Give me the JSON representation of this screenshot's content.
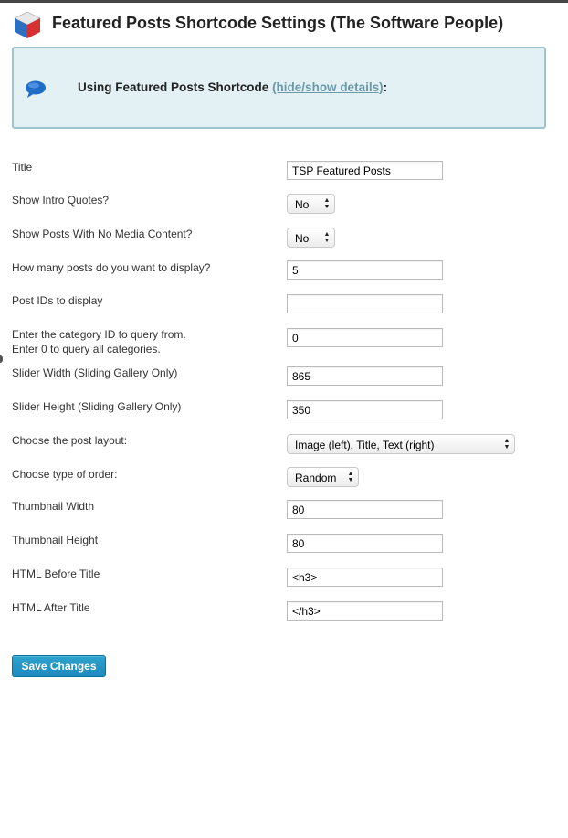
{
  "page": {
    "title": "Featured Posts Shortcode Settings (The Software People)"
  },
  "info_box": {
    "text": "Using Featured Posts Shortcode",
    "link_label": "(hide/show details)",
    "suffix": ":"
  },
  "form": {
    "title_label": "Title",
    "title_value": "TSP Featured Posts",
    "show_quotes_label": "Show Intro Quotes?",
    "show_quotes_value": "No",
    "show_no_media_label": "Show Posts With No Media Content?",
    "show_no_media_value": "No",
    "num_posts_label": "How many posts do you want to display?",
    "num_posts_value": "5",
    "post_ids_label": "Post IDs to display",
    "post_ids_value": "",
    "category_label_line1": "Enter the category ID to query from.",
    "category_label_line2": "Enter 0 to query all categories.",
    "category_value": "0",
    "slider_width_label": "Slider Width (Sliding Gallery Only)",
    "slider_width_value": "865",
    "slider_height_label": "Slider Height (Sliding Gallery Only)",
    "slider_height_value": "350",
    "layout_label": "Choose the post layout:",
    "layout_value": "Image (left), Title, Text (right)",
    "order_label": "Choose type of order:",
    "order_value": "Random",
    "thumb_width_label": "Thumbnail Width",
    "thumb_width_value": "80",
    "thumb_height_label": "Thumbnail Height",
    "thumb_height_value": "80",
    "html_before_label": "HTML Before Title",
    "html_before_value": "<h3>",
    "html_after_label": "HTML After Title",
    "html_after_value": "</h3>"
  },
  "actions": {
    "save_label": "Save Changes"
  },
  "colors": {
    "info_bg": "#e3f0f4",
    "info_border": "#9cc4cf",
    "link": "#6a9aa8",
    "button": "#2ea2cc"
  },
  "icons": {
    "plugin": "cube-icon",
    "info": "speech-bubble-icon",
    "select_arrows": "up-down-arrows-icon"
  }
}
